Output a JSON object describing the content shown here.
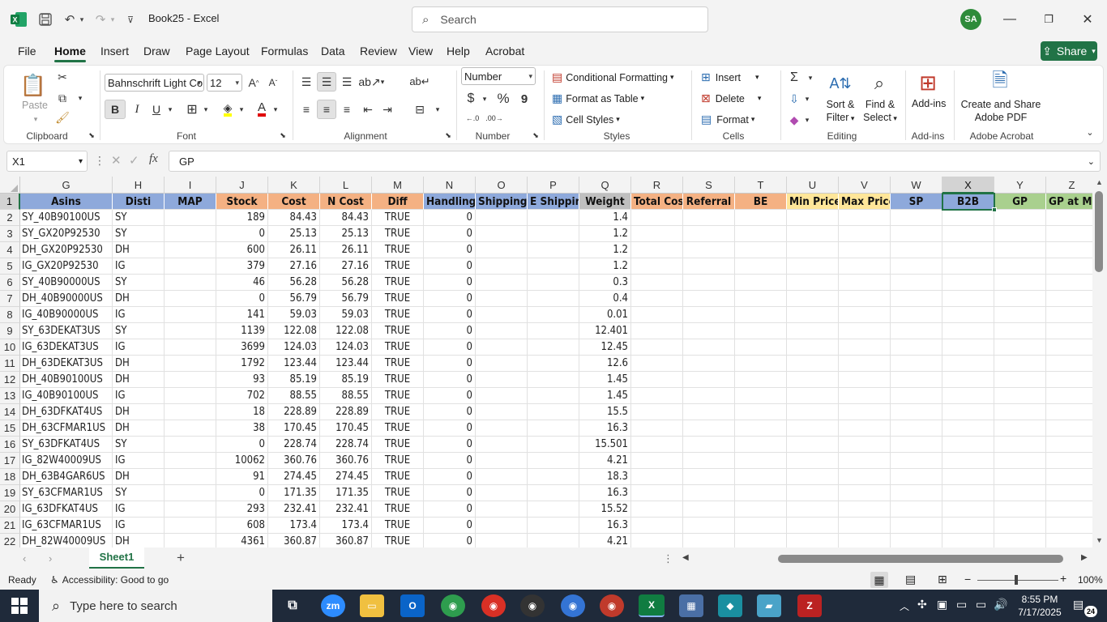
{
  "window": {
    "file_name": "Book25",
    "app_name": "Excel",
    "title_sep": " - ",
    "search_placeholder": "Search",
    "user_initials": "SA"
  },
  "tabs": [
    "File",
    "Home",
    "Insert",
    "Draw",
    "Page Layout",
    "Formulas",
    "Data",
    "Review",
    "View",
    "Help",
    "Acrobat"
  ],
  "active_tab": "Home",
  "share_label": "Share",
  "ribbon": {
    "clipboard": {
      "paste": "Paste",
      "label": "Clipboard"
    },
    "font": {
      "name": "Bahnschrift Light Co",
      "size": "12",
      "bold": "B",
      "italic": "I",
      "underline": "U",
      "label": "Font"
    },
    "alignment": {
      "label": "Alignment"
    },
    "number": {
      "format": "Number",
      "dollar": "$",
      "percent": "%",
      "comma": "9",
      "label": "Number"
    },
    "styles": {
      "conditional": "Conditional Formatting",
      "format_table": "Format as Table",
      "cell_styles": "Cell Styles",
      "label": "Styles"
    },
    "cells": {
      "insert": "Insert",
      "delete": "Delete",
      "format": "Format",
      "label": "Cells"
    },
    "editing": {
      "sort1": "Sort &",
      "sort2": "Filter",
      "find1": "Find &",
      "find2": "Select",
      "label": "Editing"
    },
    "addins": {
      "button": "Add-ins",
      "label": "Add-ins"
    },
    "acrobat": {
      "line1": "Create and Share",
      "line2": "Adobe PDF",
      "label": "Adobe Acrobat"
    }
  },
  "formula_bar": {
    "name_box": "X1",
    "fx": "fx",
    "content": "GP"
  },
  "columns": [
    {
      "letter": "G",
      "header": "Asins",
      "color": "#8ea9db"
    },
    {
      "letter": "H",
      "header": "Disti",
      "color": "#8ea9db"
    },
    {
      "letter": "I",
      "header": "MAP",
      "color": "#8ea9db"
    },
    {
      "letter": "J",
      "header": "Stock",
      "color": "#f4b183"
    },
    {
      "letter": "K",
      "header": "Cost",
      "color": "#f4b183"
    },
    {
      "letter": "L",
      "header": "N Cost",
      "color": "#f4b183"
    },
    {
      "letter": "M",
      "header": "Diff",
      "color": "#f4b183"
    },
    {
      "letter": "N",
      "header": "Handling",
      "color": "#8ea9db"
    },
    {
      "letter": "O",
      "header": "Shipping",
      "color": "#8ea9db"
    },
    {
      "letter": "P",
      "header": "E Shipping",
      "color": "#8ea9db"
    },
    {
      "letter": "Q",
      "header": "Weight",
      "color": "#bfbfbf"
    },
    {
      "letter": "R",
      "header": "Total Cost",
      "color": "#f4b183"
    },
    {
      "letter": "S",
      "header": "Referral",
      "color": "#f4b183"
    },
    {
      "letter": "T",
      "header": "BE",
      "color": "#f4b183"
    },
    {
      "letter": "U",
      "header": "Min Price",
      "color": "#ffe699"
    },
    {
      "letter": "V",
      "header": "Max Price",
      "color": "#ffe699"
    },
    {
      "letter": "W",
      "header": "SP",
      "color": "#8ea9db"
    },
    {
      "letter": "X",
      "header": "B2B",
      "color": "#8ea9db"
    },
    {
      "letter": "Y",
      "header": "GP",
      "color": "#a9d08e"
    },
    {
      "letter": "Z",
      "header": "GP at Mi",
      "color": "#a9d08e"
    }
  ],
  "rows": [
    {
      "n": "2",
      "asin": "SY_40B90100US",
      "disti": "SY",
      "stock": "189",
      "cost": "84.43",
      "ncost": "84.43",
      "diff": "TRUE",
      "handling": "0",
      "weight": "1.4"
    },
    {
      "n": "3",
      "asin": "SY_GX20P92530",
      "disti": "SY",
      "stock": "0",
      "cost": "25.13",
      "ncost": "25.13",
      "diff": "TRUE",
      "handling": "0",
      "weight": "1.2"
    },
    {
      "n": "4",
      "asin": "DH_GX20P92530",
      "disti": "DH",
      "stock": "600",
      "cost": "26.11",
      "ncost": "26.11",
      "diff": "TRUE",
      "handling": "0",
      "weight": "1.2"
    },
    {
      "n": "5",
      "asin": "IG_GX20P92530",
      "disti": "IG",
      "stock": "379",
      "cost": "27.16",
      "ncost": "27.16",
      "diff": "TRUE",
      "handling": "0",
      "weight": "1.2"
    },
    {
      "n": "6",
      "asin": "SY_40B90000US",
      "disti": "SY",
      "stock": "46",
      "cost": "56.28",
      "ncost": "56.28",
      "diff": "TRUE",
      "handling": "0",
      "weight": "0.3"
    },
    {
      "n": "7",
      "asin": "DH_40B90000US",
      "disti": "DH",
      "stock": "0",
      "cost": "56.79",
      "ncost": "56.79",
      "diff": "TRUE",
      "handling": "0",
      "weight": "0.4"
    },
    {
      "n": "8",
      "asin": "IG_40B90000US",
      "disti": "IG",
      "stock": "141",
      "cost": "59.03",
      "ncost": "59.03",
      "diff": "TRUE",
      "handling": "0",
      "weight": "0.01"
    },
    {
      "n": "9",
      "asin": "SY_63DEKAT3US",
      "disti": "SY",
      "stock": "1139",
      "cost": "122.08",
      "ncost": "122.08",
      "diff": "TRUE",
      "handling": "0",
      "weight": "12.401"
    },
    {
      "n": "10",
      "asin": "IG_63DEKAT3US",
      "disti": "IG",
      "stock": "3699",
      "cost": "124.03",
      "ncost": "124.03",
      "diff": "TRUE",
      "handling": "0",
      "weight": "12.45"
    },
    {
      "n": "11",
      "asin": "DH_63DEKAT3US",
      "disti": "DH",
      "stock": "1792",
      "cost": "123.44",
      "ncost": "123.44",
      "diff": "TRUE",
      "handling": "0",
      "weight": "12.6"
    },
    {
      "n": "12",
      "asin": "DH_40B90100US",
      "disti": "DH",
      "stock": "93",
      "cost": "85.19",
      "ncost": "85.19",
      "diff": "TRUE",
      "handling": "0",
      "weight": "1.45"
    },
    {
      "n": "13",
      "asin": "IG_40B90100US",
      "disti": "IG",
      "stock": "702",
      "cost": "88.55",
      "ncost": "88.55",
      "diff": "TRUE",
      "handling": "0",
      "weight": "1.45"
    },
    {
      "n": "14",
      "asin": "DH_63DFKAT4US",
      "disti": "DH",
      "stock": "18",
      "cost": "228.89",
      "ncost": "228.89",
      "diff": "TRUE",
      "handling": "0",
      "weight": "15.5"
    },
    {
      "n": "15",
      "asin": "DH_63CFMAR1US",
      "disti": "DH",
      "stock": "38",
      "cost": "170.45",
      "ncost": "170.45",
      "diff": "TRUE",
      "handling": "0",
      "weight": "16.3"
    },
    {
      "n": "16",
      "asin": "SY_63DFKAT4US",
      "disti": "SY",
      "stock": "0",
      "cost": "228.74",
      "ncost": "228.74",
      "diff": "TRUE",
      "handling": "0",
      "weight": "15.501"
    },
    {
      "n": "17",
      "asin": "IG_82W40009US",
      "disti": "IG",
      "stock": "10062",
      "cost": "360.76",
      "ncost": "360.76",
      "diff": "TRUE",
      "handling": "0",
      "weight": "4.21"
    },
    {
      "n": "18",
      "asin": "DH_63B4GAR6US",
      "disti": "DH",
      "stock": "91",
      "cost": "274.45",
      "ncost": "274.45",
      "diff": "TRUE",
      "handling": "0",
      "weight": "18.3"
    },
    {
      "n": "19",
      "asin": "SY_63CFMAR1US",
      "disti": "SY",
      "stock": "0",
      "cost": "171.35",
      "ncost": "171.35",
      "diff": "TRUE",
      "handling": "0",
      "weight": "16.3"
    },
    {
      "n": "20",
      "asin": "IG_63DFKAT4US",
      "disti": "IG",
      "stock": "293",
      "cost": "232.41",
      "ncost": "232.41",
      "diff": "TRUE",
      "handling": "0",
      "weight": "15.52"
    },
    {
      "n": "21",
      "asin": "IG_63CFMAR1US",
      "disti": "IG",
      "stock": "608",
      "cost": "173.4",
      "ncost": "173.4",
      "diff": "TRUE",
      "handling": "0",
      "weight": "16.3"
    },
    {
      "n": "22",
      "asin": "DH_82W40009US",
      "disti": "DH",
      "stock": "4361",
      "cost": "360.87",
      "ncost": "360.87",
      "diff": "TRUE",
      "handling": "0",
      "weight": "4.21"
    }
  ],
  "header_row_number": "1",
  "selected_column": "X",
  "sheet_tab": "Sheet1",
  "status": {
    "ready": "Ready",
    "accessibility": "Accessibility: Good to go",
    "zoom": "100%"
  },
  "taskbar": {
    "search_placeholder": "Type here to search",
    "time": "8:55 PM",
    "date": "7/17/2025",
    "notif_count": "24"
  },
  "colors": {
    "accent": "#217346",
    "taskbar": "#1f2a3a"
  }
}
